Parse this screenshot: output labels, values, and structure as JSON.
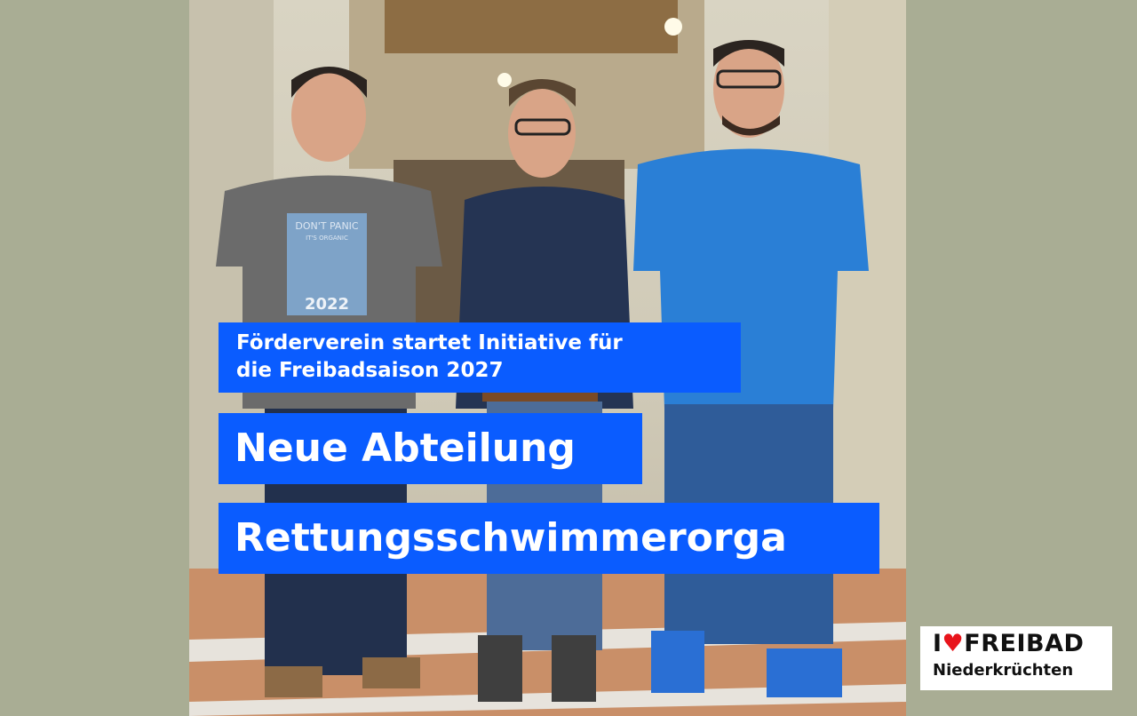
{
  "headline": {
    "subheadline_line1": "Förderverein startet Initiative für",
    "subheadline_line2": "die Freibadsaison 2027",
    "line1": "Neue Abteilung",
    "line2": "Rettungsschwimmerorga"
  },
  "logo": {
    "i_text": "I",
    "heart_glyph": "♥",
    "brand": "FREIBAD",
    "place": "Niederkrüchten"
  },
  "shirt_print": {
    "line1": "DON'T PANIC",
    "line2": "IT'S ORGANIC",
    "year": "2022"
  },
  "colors": {
    "background": "#a9ad94",
    "banner_blue": "#0a5cff",
    "logo_heart_red": "#e8141b"
  }
}
